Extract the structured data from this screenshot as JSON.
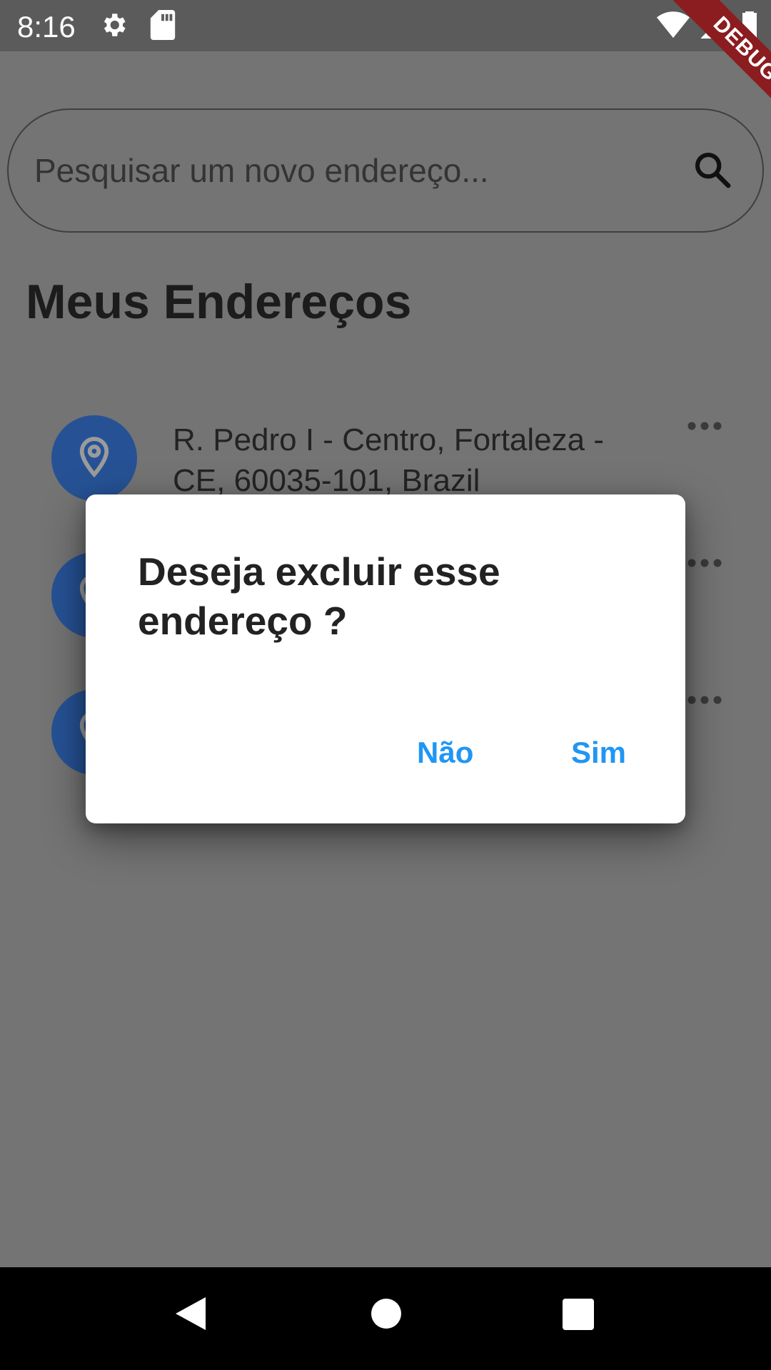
{
  "status_bar": {
    "time": "8:16",
    "left_icons": [
      "settings-icon",
      "sd-card-icon"
    ],
    "right_icons": [
      "wifi-icon",
      "signal-icon",
      "battery-icon"
    ]
  },
  "debug_banner": "DEBUG",
  "search": {
    "placeholder": "Pesquisar um novo endereço..."
  },
  "page": {
    "title": "Meus Endereços"
  },
  "addresses": [
    {
      "text": "R. Pedro I - Centro, Fortaleza - CE, 60035-101, Brazil",
      "icon": "location-pin-icon"
    },
    {
      "text": "",
      "icon": "location-pin-icon"
    },
    {
      "text": "",
      "icon": "location-pin-icon"
    }
  ],
  "dialog": {
    "title": "Deseja excluir esse endereço ?",
    "cancel_label": "Não",
    "confirm_label": "Sim"
  },
  "colors": {
    "accent": "#2196f3",
    "avatar": "#0d47a1",
    "debug_banner": "#8b1c1f"
  },
  "nav_bar": [
    "back-icon",
    "home-icon",
    "recents-icon"
  ]
}
